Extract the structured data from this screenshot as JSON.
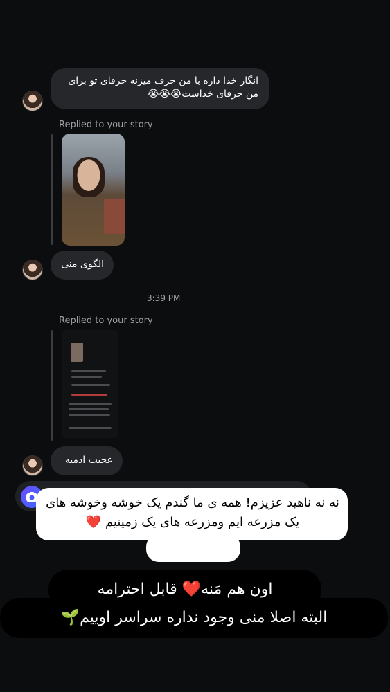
{
  "messages": {
    "m1": "انگار خدا داره با من حرف میزنه حرفای تو برای من حرفای خداست😭😭😭",
    "reply1_label": "Replied to your story",
    "m2": "الگوی منی",
    "time": "3:39 PM",
    "reply2_label": "Replied to your story",
    "m3": "عجیب ادمیه"
  },
  "overlay": {
    "white_text": "نه نه ناهید عزیزم! همه ی ما گندم یک خوشه وخوشه های یک مزرعه ایم ومزرعه های یک زمینیم ❤️",
    "dark_line1": "اون هم مَنه❤️ قابل احترامه",
    "dark_line2": "البته اصلا منی وجود نداره سراسر اوییم🌱"
  },
  "icons": {
    "camera": "camera-icon",
    "avatar": "avatar"
  },
  "colors": {
    "background": "#0c0d0f",
    "bubble": "#25272b",
    "camera_gradient_start": "#6b4cff",
    "camera_gradient_end": "#3a6bff"
  }
}
